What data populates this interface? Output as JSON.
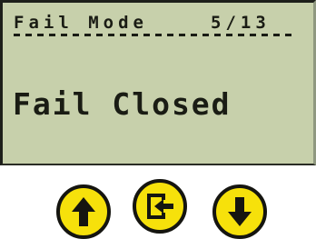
{
  "display": {
    "menu_title": "Fail Mode",
    "page_indicator": "5/13",
    "value": "Fail Closed",
    "background_color": "#c7d0ab",
    "text_color": "#1a1c14"
  },
  "buttons": [
    {
      "name": "up-button",
      "icon": "arrow-up-icon"
    },
    {
      "name": "enter-button",
      "icon": "enter-icon"
    },
    {
      "name": "down-button",
      "icon": "arrow-down-icon"
    }
  ],
  "button_color": "#f6e10b"
}
